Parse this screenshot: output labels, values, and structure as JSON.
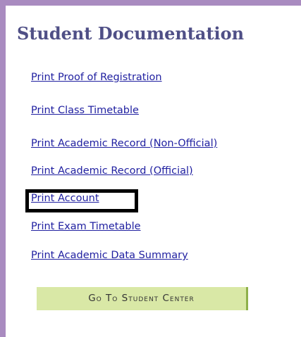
{
  "page": {
    "title": "Student Documentation"
  },
  "links": [
    {
      "label": "Print Proof of Registration"
    },
    {
      "label": "Print Class Timetable"
    },
    {
      "label": "Print Academic Record (Non-Official)"
    },
    {
      "label": "Print Academic Record (Official)"
    },
    {
      "label": "Print Account"
    },
    {
      "label": "Print Exam Timetable"
    },
    {
      "label": "Print Academic Data Summary"
    }
  ],
  "button": {
    "label": "Go To Student Center"
  },
  "colors": {
    "border": "#a98bc0",
    "title": "#4f4f86",
    "link": "#1f1fa0",
    "button_bg": "#d9e8a6",
    "button_accent": "#8eb04a",
    "highlight": "#000000"
  }
}
